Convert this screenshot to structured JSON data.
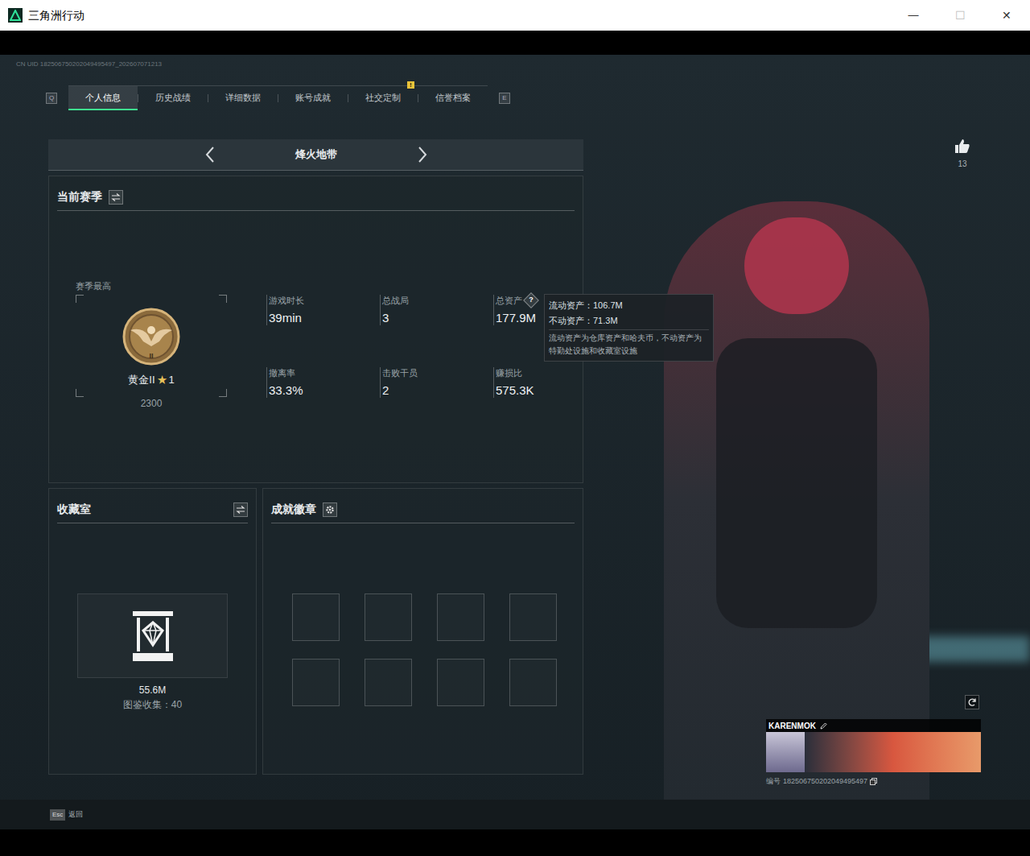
{
  "window": {
    "title": "三角洲行动",
    "controls": [
      "—",
      "☐",
      "✕"
    ]
  },
  "uid": "CN UID 182506750202049495497_202607071213",
  "tabs": {
    "prev_key": "Q",
    "next_key": "E",
    "notice_glyph": "!",
    "items": [
      {
        "label": "个人信息",
        "selected": true,
        "notice": false
      },
      {
        "label": "历史战绩",
        "selected": false,
        "notice": false
      },
      {
        "label": "详细数据",
        "selected": false,
        "notice": false
      },
      {
        "label": "账号成就",
        "selected": false,
        "notice": false
      },
      {
        "label": "社交定制",
        "selected": false,
        "notice": true
      },
      {
        "label": "信誉档案",
        "selected": false,
        "notice": false
      }
    ]
  },
  "mode": {
    "title": "烽火地带"
  },
  "season": {
    "title": "当前赛季",
    "best_label": "赛季最高",
    "emblem_tier": "II",
    "rank": "黄金II",
    "star": "★",
    "star_count": "1",
    "score": "2300",
    "help_glyph": "?",
    "stats": [
      {
        "label": "游戏时长",
        "value": "39min",
        "help": false
      },
      {
        "label": "总战局",
        "value": "3",
        "help": false
      },
      {
        "label": "总资产",
        "value": "177.9M",
        "help": true
      },
      {
        "label": "撤离率",
        "value": "33.3%",
        "help": false
      },
      {
        "label": "击败干员",
        "value": "2",
        "help": false
      },
      {
        "label": "赚损比",
        "value": "575.3K",
        "help": false
      }
    ]
  },
  "tooltip": {
    "lines": [
      "流动资产：106.7M",
      "不动资产：71.3M"
    ],
    "note": "流动资产为仓库资产和哈夫币，不动资产为特勤处设施和收藏室设施"
  },
  "collection": {
    "title": "收藏室",
    "value": "55.6M",
    "caption": "图鉴收集：40"
  },
  "achievements": {
    "title": "成就徽章",
    "slots": [
      {
        "filled": false
      },
      {
        "filled": false
      },
      {
        "filled": false
      },
      {
        "filled": false
      },
      {
        "filled": false
      },
      {
        "filled": false
      },
      {
        "filled": false
      },
      {
        "filled": false
      }
    ]
  },
  "likes": {
    "count": "13"
  },
  "card": {
    "name": "KARENMOK",
    "id_label": "编号",
    "id": "182506750202049495497"
  },
  "footer": {
    "key": "Esc",
    "label": "返回"
  }
}
